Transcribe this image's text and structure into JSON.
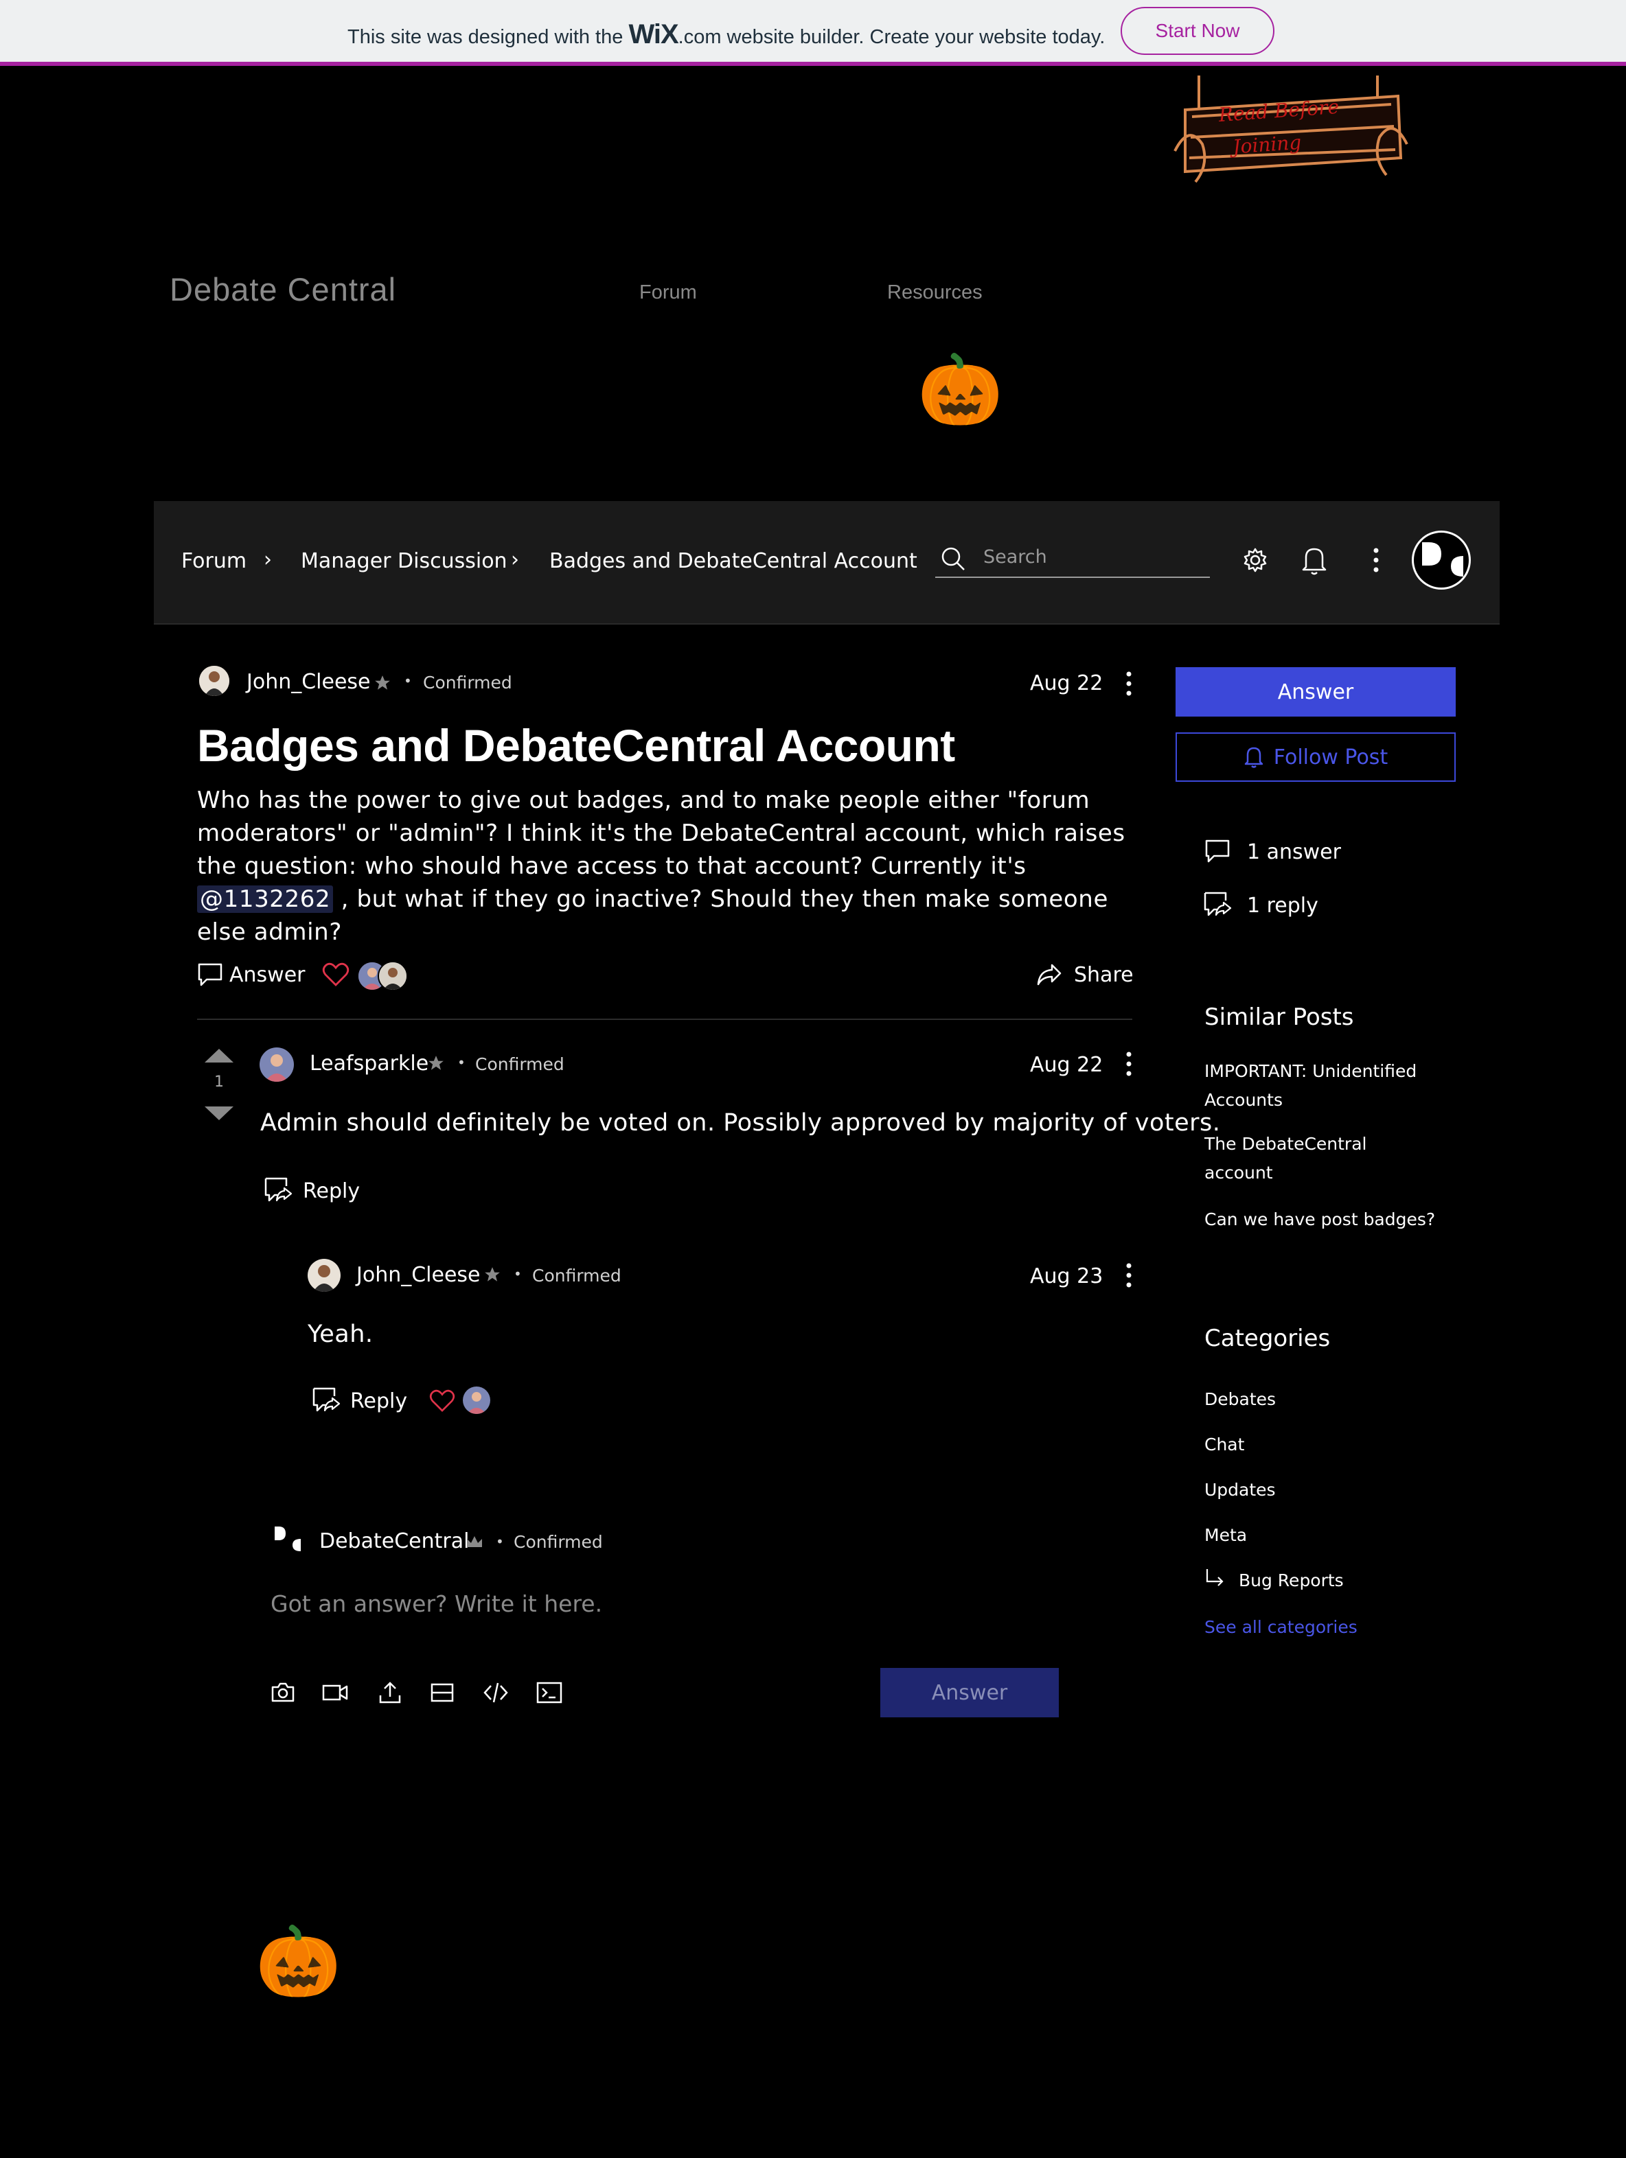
{
  "wix_banner": {
    "text_before": "This site was designed with the ",
    "logo_wix": "WiX",
    "logo_com": ".com",
    "text_after": " website builder. Create your website today.",
    "cta": "Start Now"
  },
  "header": {
    "site_title": "Debate Central",
    "nav": [
      "Forum",
      "Resources"
    ],
    "sign_lines": [
      "Read Before",
      "Joining"
    ],
    "pumpkin": "🎃"
  },
  "forum_bar": {
    "breadcrumb": [
      "Forum",
      "Manager Discussion",
      "Badges and DebateCentral Account"
    ],
    "separator": "›",
    "search_placeholder": "Search"
  },
  "post": {
    "author": "John_Cleese",
    "status": "Confirmed",
    "date": "Aug 22",
    "title": "Badges and DebateCentral Account",
    "body_before": "Who has the power to give out badges, and to make people either \"forum moderators\" or \"admin\"? I think it's the DebateCentral account, which raises the question: who should have access to that account? Currently it's ",
    "mention": "@1132262",
    "body_after": " , but what if they go inactive? Should they then make someone else admin?",
    "answer_label": "Answer",
    "share_label": "Share"
  },
  "answer": {
    "author": "Leafsparkle",
    "status": "Confirmed",
    "date": "Aug 22",
    "votes": "1",
    "text": "Admin should definitely be voted on. Possibly approved by majority of voters.",
    "reply_label": "Reply"
  },
  "reply": {
    "author": "John_Cleese",
    "status": "Confirmed",
    "date": "Aug 23",
    "text": "Yeah.",
    "reply_label": "Reply"
  },
  "composer": {
    "author": "DebateCentral",
    "status": "Confirmed",
    "placeholder": "Got an answer? Write it here.",
    "submit_label": "Answer"
  },
  "sidebar": {
    "answer_button": "Answer",
    "follow_button": "Follow Post",
    "answers_count": "1 answer",
    "replies_count": "1 reply",
    "similar_heading": "Similar Posts",
    "similar_posts": [
      "IMPORTANT: Unidentified Accounts",
      "The DebateCentral account",
      "Can we have post badges?"
    ],
    "categories_heading": "Categories",
    "categories": [
      "Debates",
      "Chat",
      "Updates",
      "Meta"
    ],
    "subcategory": "Bug Reports",
    "see_all": "See all categories"
  },
  "colors": {
    "accent": "#3c48d9",
    "wix_purple": "#a622a0",
    "heart": "#e0334a"
  }
}
